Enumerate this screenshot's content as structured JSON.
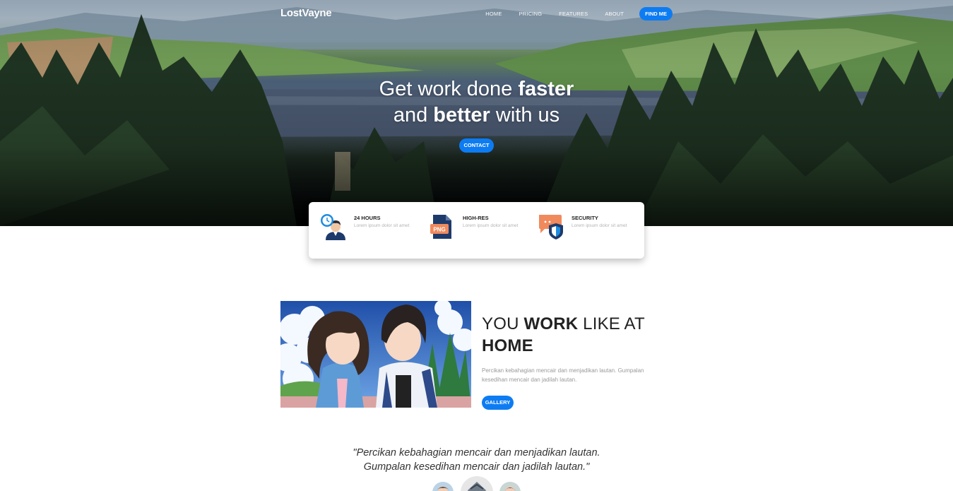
{
  "nav": {
    "brand": "LostVayne",
    "links": [
      "HOME",
      "PRICING",
      "FEATURES",
      "ABOUT"
    ],
    "cta": "FIND ME"
  },
  "hero": {
    "line1_pre": "Get work done ",
    "line1_bold": "faster",
    "line2_pre": "and ",
    "line2_bold": "better",
    "line2_post": " with us",
    "button": "CONTACT"
  },
  "features": [
    {
      "title": "24 HOURS",
      "desc": "Lorem ipsum dolor sit amet",
      "icon": "clock-person-icon"
    },
    {
      "title": "HIGH-RES",
      "desc": "Lorem ipsum dolor sit amet",
      "icon": "png-file-icon",
      "icon_text": "PNG"
    },
    {
      "title": "SECURITY",
      "desc": "Lorem ipsum dolor sit amet",
      "icon": "shield-chat-icon"
    }
  ],
  "about": {
    "title_pre": "YOU ",
    "title_bold": "WORK",
    "title_post": " LIKE AT",
    "title_line2": "HOME",
    "text": "Percikan kebahagian mencair dan menjadikan lautan. Gumpalan kesedihan mencair dan jadilah lautan.",
    "button": "GALLERY"
  },
  "quote": {
    "line1": "\"Percikan kebahagian mencair dan menjadikan lautan.",
    "line2": "Gumpalan kesedihan mencair dan jadilah lautan.\""
  },
  "colors": {
    "accent": "#0d7cf2"
  }
}
